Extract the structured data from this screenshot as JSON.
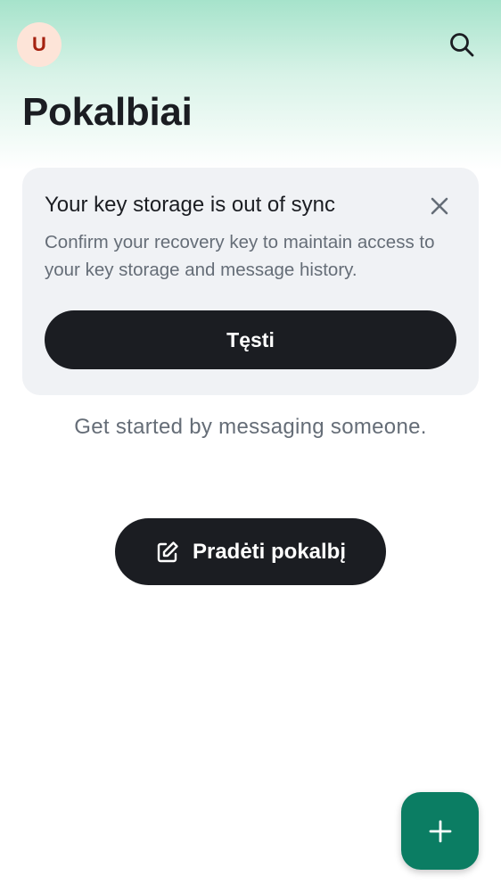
{
  "header": {
    "avatar_initial": "U",
    "search_icon": "search-icon",
    "title": "Pokalbiai"
  },
  "banner": {
    "title": "Your key storage is out of sync",
    "body": "Confirm your recovery key to maintain access to your key storage and message history.",
    "action_label": "Tęsti",
    "close_icon": "close-icon"
  },
  "empty_state": {
    "message": "Get started by messaging someone.",
    "start_chat_label": "Pradėti pokalbį",
    "start_chat_icon": "compose-icon"
  },
  "fab": {
    "icon": "plus-icon"
  },
  "colors": {
    "accent": "#0b7d63",
    "primary_button": "#1b1d22",
    "avatar_bg": "#fde4d8",
    "avatar_text": "#a5210f",
    "banner_bg": "#f0f2f5",
    "secondary_text": "#656d77"
  }
}
